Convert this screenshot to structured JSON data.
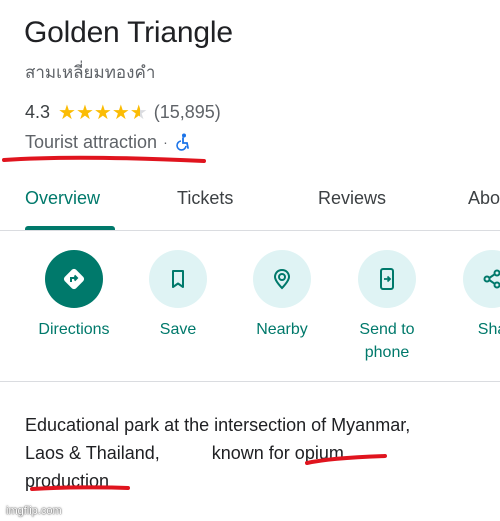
{
  "place": {
    "title": "Golden Triangle",
    "subtitle": "สามเหลี่ยมทองคำ",
    "rating": "4.3",
    "stars": 4.3,
    "review_count": "(15,895)",
    "category": "Tourist attraction",
    "separator": "·",
    "accessibility_icon": "wheelchair-icon"
  },
  "tabs": [
    {
      "label": "Overview",
      "active": true
    },
    {
      "label": "Tickets",
      "active": false
    },
    {
      "label": "Reviews",
      "active": false
    },
    {
      "label": "Abo",
      "active": false
    }
  ],
  "actions": [
    {
      "label": "Directions",
      "icon": "directions-icon"
    },
    {
      "label": "Save",
      "icon": "bookmark-icon"
    },
    {
      "label": "Nearby",
      "icon": "nearby-icon"
    },
    {
      "label": "Send to phone",
      "icon": "send-to-phone-icon"
    },
    {
      "label": "Sha",
      "icon": "share-icon"
    }
  ],
  "description": {
    "line1": "Educational park at the intersection of Myanmar,",
    "line2a": "Laos & Thailand,",
    "line2b": "known for opium",
    "line3": "production"
  },
  "annotation_color": "#e0141e",
  "accent_color": "#00796b",
  "watermark": "imgflip.com"
}
